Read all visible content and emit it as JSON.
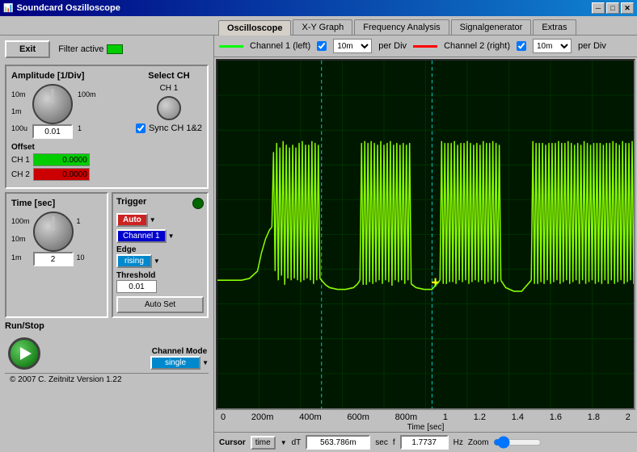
{
  "titlebar": {
    "title": "Soundcard Oszilloscope",
    "icon": "📊",
    "minimize": "─",
    "maximize": "□",
    "close": "✕"
  },
  "tabs": [
    {
      "id": "oscilloscope",
      "label": "Oscilloscope",
      "active": true
    },
    {
      "id": "xy-graph",
      "label": "X-Y Graph",
      "active": false
    },
    {
      "id": "frequency-analysis",
      "label": "Frequency Analysis",
      "active": false
    },
    {
      "id": "signal-generator",
      "label": "Signalgenerator",
      "active": false
    },
    {
      "id": "extras",
      "label": "Extras",
      "active": false
    }
  ],
  "left": {
    "exit_label": "Exit",
    "filter_label": "Filter active",
    "amplitude": {
      "title": "Amplitude [1/Div]",
      "knob_min": "10m",
      "knob_mid": "100m",
      "knob_max_top": "1",
      "knob_left": "1m",
      "knob_bottom": "100u",
      "value": "0.01",
      "select_ch_label": "Select CH",
      "ch1_label": "CH 1",
      "sync_label": "Sync CH 1&2",
      "offset_label": "Offset",
      "ch1_offset": "0.0000",
      "ch2_offset": "0.0000"
    },
    "time": {
      "title": "Time [sec]",
      "knob_top": "100m",
      "knob_left": "10m",
      "knob_right": "1",
      "knob_bottom": "1m",
      "knob_far_right": "10",
      "value": "2"
    },
    "trigger": {
      "title": "Trigger",
      "mode_label": "Auto",
      "channel_label": "Channel 1",
      "edge_title": "Edge",
      "edge_value": "rising",
      "threshold_title": "Threshold",
      "threshold_value": "0.01",
      "auto_set_label": "Auto Set",
      "channel_mode_title": "Channel Mode",
      "channel_mode_value": "single"
    },
    "runstop": {
      "title": "Run/Stop"
    }
  },
  "channel_bar": {
    "ch1_label": "Channel 1 (left)",
    "ch1_per_div": "10m",
    "ch1_unit": "per Div",
    "ch2_label": "Channel 2 (right)",
    "ch2_per_div": "10m",
    "ch2_unit": "per Div"
  },
  "x_axis": {
    "labels": [
      "0",
      "200m",
      "400m",
      "600m",
      "800m",
      "1",
      "1.2",
      "1.4",
      "1.6",
      "1.8",
      "2"
    ],
    "title": "Time [sec]"
  },
  "cursor_bar": {
    "cursor_label": "Cursor",
    "type_label": "time",
    "dt_label": "dT",
    "dt_value": "563.786m",
    "dt_unit": "sec",
    "f_label": "f",
    "f_value": "1.7737",
    "f_unit": "Hz",
    "zoom_label": "Zoom"
  },
  "copyright": "© 2007  C. Zeitnitz Version 1.22"
}
